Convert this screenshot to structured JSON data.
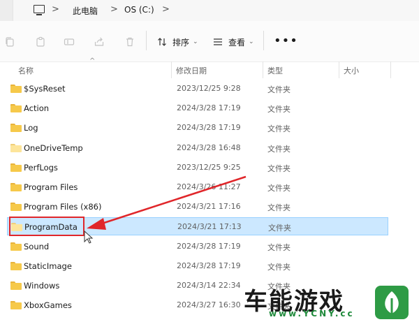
{
  "address_bar": {
    "crumbs": [
      "此电脑",
      "OS (C:)"
    ],
    "chevrons": [
      ">",
      ">",
      ">"
    ]
  },
  "toolbar": {
    "sort_label": "排序",
    "view_label": "查看",
    "more_label": "•••",
    "icons": [
      "copy-icon",
      "paste-icon",
      "rename-icon",
      "share-icon",
      "delete-icon"
    ]
  },
  "columns": {
    "name": "名称",
    "modified": "修改日期",
    "type": "类型",
    "size": "大小"
  },
  "files": [
    {
      "name": "$SysReset",
      "date": "2023/12/25 9:28",
      "type": "文件夹",
      "light": false,
      "selected": false
    },
    {
      "name": "Action",
      "date": "2024/3/28 17:19",
      "type": "文件夹",
      "light": false,
      "selected": false
    },
    {
      "name": "Log",
      "date": "2024/3/28 17:19",
      "type": "文件夹",
      "light": false,
      "selected": false
    },
    {
      "name": "OneDriveTemp",
      "date": "2024/3/28 16:48",
      "type": "文件夹",
      "light": true,
      "selected": false
    },
    {
      "name": "PerfLogs",
      "date": "2023/12/25 9:25",
      "type": "文件夹",
      "light": false,
      "selected": false
    },
    {
      "name": "Program Files",
      "date": "2024/3/26 11:27",
      "type": "文件夹",
      "light": false,
      "selected": false
    },
    {
      "name": "Program Files (x86)",
      "date": "2024/3/21 17:16",
      "type": "文件夹",
      "light": false,
      "selected": false
    },
    {
      "name": "ProgramData",
      "date": "2024/3/21 17:13",
      "type": "文件夹",
      "light": true,
      "selected": true
    },
    {
      "name": "Sound",
      "date": "2024/3/28 17:19",
      "type": "文件夹",
      "light": false,
      "selected": false
    },
    {
      "name": "StaticImage",
      "date": "2024/3/28 17:19",
      "type": "文件夹",
      "light": false,
      "selected": false
    },
    {
      "name": "Windows",
      "date": "2024/3/14 22:34",
      "type": "文件夹",
      "light": false,
      "selected": false
    },
    {
      "name": "XboxGames",
      "date": "2024/3/27 16:30",
      "type": "文件夹",
      "light": false,
      "selected": false
    }
  ],
  "watermark": {
    "brand": "车能游戏",
    "site": "www.YCNY.cc"
  },
  "colors": {
    "selection": "#cce8ff",
    "annotation": "#e0262a",
    "folder": "#f6c94a",
    "watermark_green": "#1f8a3b"
  }
}
